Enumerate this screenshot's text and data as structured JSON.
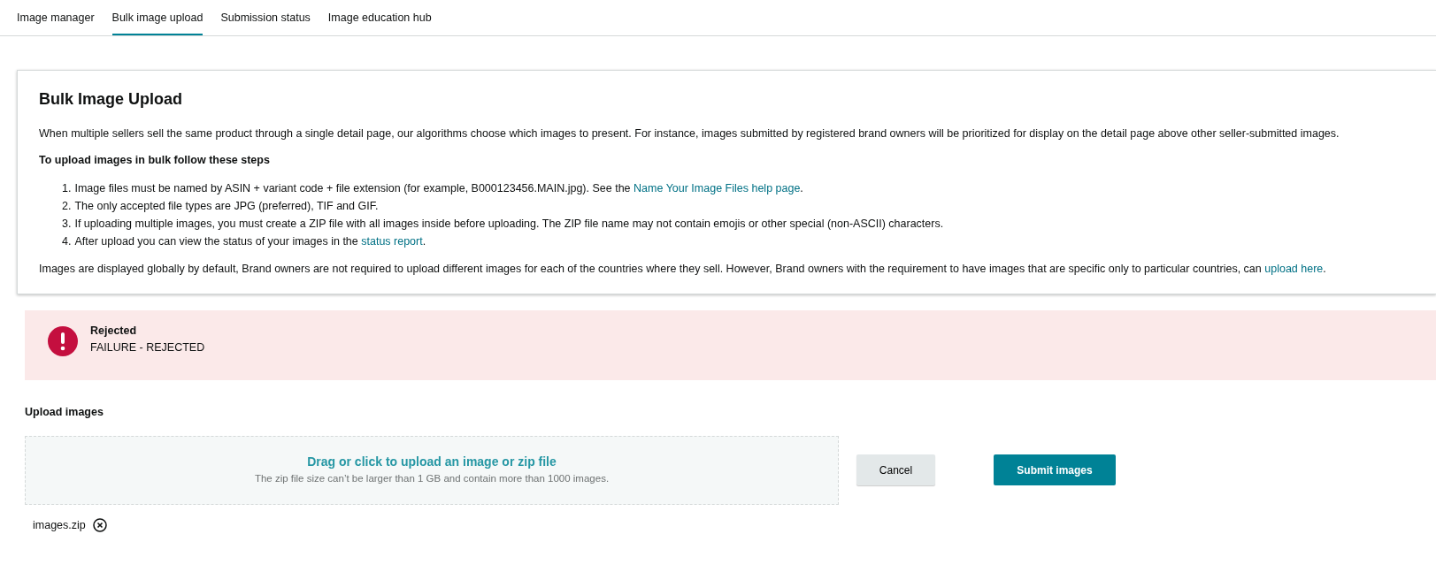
{
  "tabs": [
    {
      "label": "Image manager",
      "selected": false
    },
    {
      "label": "Bulk image upload",
      "selected": true
    },
    {
      "label": "Submission status",
      "selected": false
    },
    {
      "label": "Image education hub",
      "selected": false
    }
  ],
  "info": {
    "title": "Bulk Image Upload",
    "intro": "When multiple sellers sell the same product through a single detail page, our algorithms choose which images to present. For instance, images submitted by registered brand owners will be prioritized for display on the detail page above other seller-submitted images.",
    "steps_heading": "To upload images in bulk follow these steps",
    "steps": [
      {
        "marker": "1.",
        "text": "Image files must be named by ASIN + variant code + file extension (for example, B000123456.MAIN.jpg). See the ",
        "link": "Name Your Image Files help page",
        "after": "."
      },
      {
        "marker": "2.",
        "text": "The only accepted file types are JPG (preferred), TIF and GIF."
      },
      {
        "marker": "3.",
        "text": "If uploading multiple images, you must create a ZIP file with all images inside before uploading. The ZIP file name may not contain emojis or other special (non-ASCII) characters."
      },
      {
        "marker": "4.",
        "text": "After upload you can view the status of your images in the ",
        "link": "status report",
        "after": "."
      }
    ],
    "footer": {
      "text": "Images are displayed globally by default, Brand owners are not required to upload different images for each of the countries where they sell. However, Brand owners with the requirement to have images that are specific only to particular countries, can ",
      "link": "upload here",
      "after": "."
    }
  },
  "alert": {
    "kind": "error",
    "title": "Rejected",
    "message": "FAILURE - REJECTED"
  },
  "upload": {
    "label": "Upload images",
    "drop_title": "Drag or click to upload an image or zip file",
    "drop_hint": "The zip file size can’t be larger than 1 GB and contain more than 1000 images.",
    "buttons": [
      {
        "label": "Cancel",
        "kind": "secondary"
      },
      {
        "label": "Submit images",
        "kind": "primary"
      }
    ],
    "files": [
      {
        "name": "images.zip"
      }
    ]
  }
}
